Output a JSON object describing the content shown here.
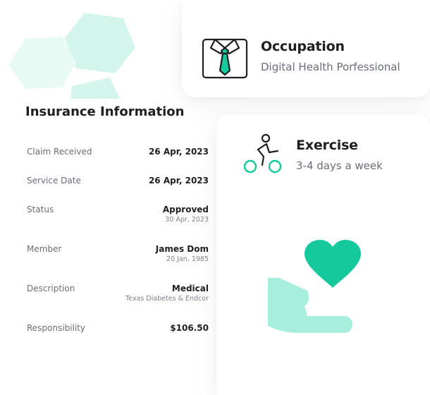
{
  "occupation": {
    "title": "Occupation",
    "subtitle": "Digital Health Porfessional",
    "icon": "shirt-and-tie-icon"
  },
  "exercise": {
    "title": "Exercise",
    "subtitle": "3-4 days a week",
    "icon": "cyclist-icon"
  },
  "illustration": {
    "icon": "heart-in-hand-icon"
  },
  "insurance": {
    "title": "Insurance Information",
    "rows": [
      {
        "label": "Claim Received",
        "value": "26 Apr, 2023",
        "sub": ""
      },
      {
        "label": "Service Date",
        "value": "26 Apr, 2023",
        "sub": ""
      },
      {
        "label": "Status",
        "value": "Approved",
        "sub": "30 Apr, 2023"
      },
      {
        "label": "Member",
        "value": "James Dom",
        "sub": "20 Jan, 1985"
      },
      {
        "label": "Description",
        "value": "Medical",
        "sub": "Texas Diabetes & Endcor"
      },
      {
        "label": "Responsibility",
        "value": "$106.50",
        "sub": ""
      }
    ]
  },
  "colors": {
    "accent": "#15c99d",
    "accent_light": "#a8eedd",
    "hex_light": "#d4f5ec"
  }
}
